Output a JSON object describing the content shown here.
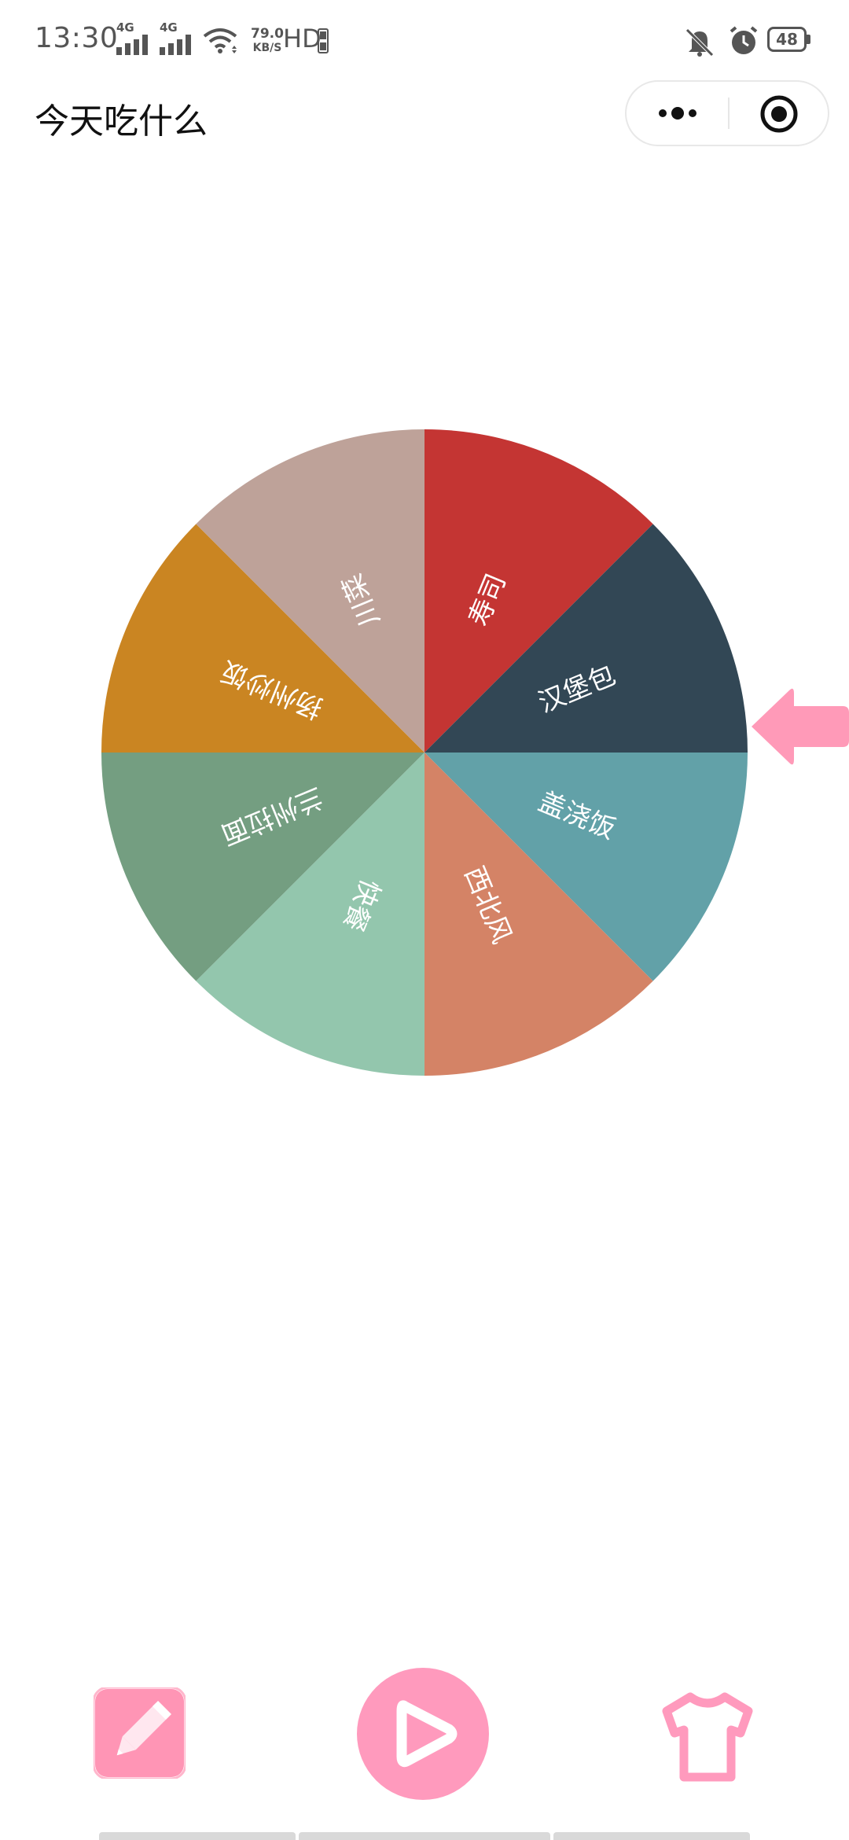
{
  "status_bar": {
    "time": "13:30",
    "signal1_label": "4G",
    "signal2_label": "4G",
    "net_speed_value": "79.0",
    "net_speed_unit": "KB/S",
    "hd_label": "HD",
    "battery": "48",
    "icons": [
      "wifi-icon",
      "mute-icon",
      "alarm-icon",
      "battery-icon"
    ]
  },
  "header": {
    "title": "今天吃什么",
    "more_icon": "more-dots-icon",
    "close_icon": "target-icon"
  },
  "wheel": {
    "segments": [
      {
        "label": "寿司",
        "color": "#C43533"
      },
      {
        "label": "汉堡包",
        "color": "#324755"
      },
      {
        "label": "盖浇饭",
        "color": "#62A1A8"
      },
      {
        "label": "西北风",
        "color": "#D48366"
      },
      {
        "label": "快餐",
        "color": "#93C6AD"
      },
      {
        "label": "兰州拉面",
        "color": "#749E81"
      },
      {
        "label": "扬州炒饭",
        "color": "#CA8522"
      },
      {
        "label": "川菜",
        "color": "#BEA299"
      }
    ],
    "pointer_color": "#FF9AB8"
  },
  "controls": {
    "edit_icon": "pencil-icon",
    "play_icon": "play-icon",
    "skin_icon": "tshirt-icon",
    "accent_color": "#FF9ABD"
  }
}
